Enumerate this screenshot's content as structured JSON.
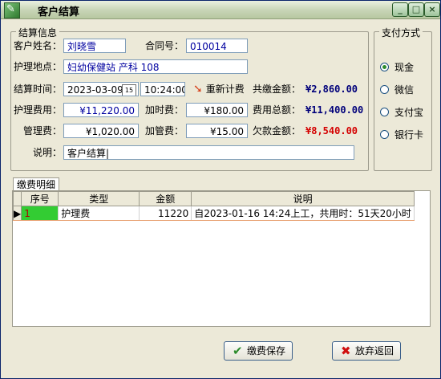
{
  "window": {
    "title": "客户结算",
    "controls": {
      "minimize": "_",
      "maximize": "□",
      "close": "×"
    }
  },
  "settlement": {
    "group_title": "结算信息",
    "customer_name_label": "客户姓名：",
    "customer_name": "刘晓雪",
    "contract_no_label": "合同号：",
    "contract_no": "010014",
    "location_label": "护理地点：",
    "location": "妇幼保健站 产科 108",
    "settle_time_label": "结算时间：",
    "settle_date": "2023-03-09",
    "settle_time": "10:24:00",
    "calendar_glyph": "15",
    "recalc_label": "重新计费",
    "paid_total_label": "共缴金额：",
    "paid_total": "¥2,860.00",
    "care_fee_label": "护理费用：",
    "care_fee": "¥11,220.00",
    "overtime_fee_label": "加时费：",
    "overtime_fee": "¥180.00",
    "fee_total_label": "费用总额：",
    "fee_total": "¥11,400.00",
    "mgmt_fee_label": "管理费：",
    "mgmt_fee": "¥1,020.00",
    "extra_mgmt_fee_label": "加管费：",
    "extra_mgmt_fee": "¥15.00",
    "owed_label": "欠款金额：",
    "owed": "¥8,540.00",
    "remark_label": "说明：",
    "remark": "客户结算|"
  },
  "payment": {
    "group_title": "支付方式",
    "options": [
      {
        "label": "现金",
        "selected": true
      },
      {
        "label": "微信",
        "selected": false
      },
      {
        "label": "支付宝",
        "selected": false
      },
      {
        "label": "银行卡",
        "selected": false
      }
    ]
  },
  "details": {
    "tab_label": "缴费明细",
    "columns": [
      "序号",
      "类型",
      "金额",
      "说明"
    ],
    "rows": [
      {
        "indicator": "▶",
        "seq": "1",
        "type": "护理费",
        "amount": "11220",
        "desc": "自2023-01-16 14:24上工，共用时：51天20小时"
      }
    ]
  },
  "actions": {
    "save_label": "缴费保存",
    "cancel_label": "放弃返回"
  },
  "colors": {
    "amount_blue": "#00007a",
    "amount_red": "#d40000",
    "value_blue": "#0000a0",
    "selected_cell": "#33cc33"
  }
}
